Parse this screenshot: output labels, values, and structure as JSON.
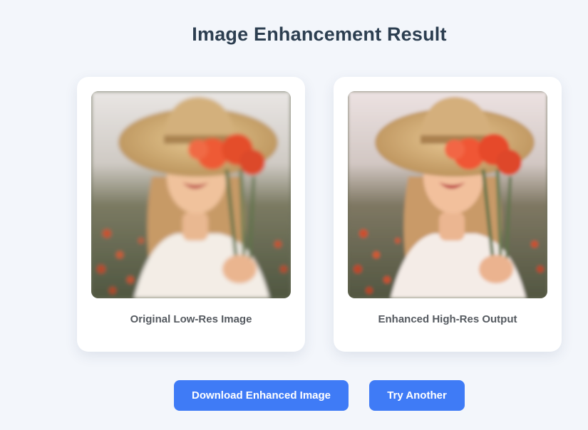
{
  "page": {
    "title": "Image Enhancement Result"
  },
  "cards": {
    "original": {
      "caption": "Original Low-Res Image",
      "image_subject": "woman in straw hat holding red poppies"
    },
    "enhanced": {
      "caption": "Enhanced High-Res Output",
      "image_subject": "woman in straw hat holding red poppies"
    }
  },
  "actions": {
    "download_label": "Download Enhanced Image",
    "try_another_label": "Try Another"
  },
  "colors": {
    "background": "#f3f6fb",
    "card": "#ffffff",
    "title": "#2c3e50",
    "caption": "#555a60",
    "button": "#3f7bf6",
    "button_text": "#ffffff"
  }
}
